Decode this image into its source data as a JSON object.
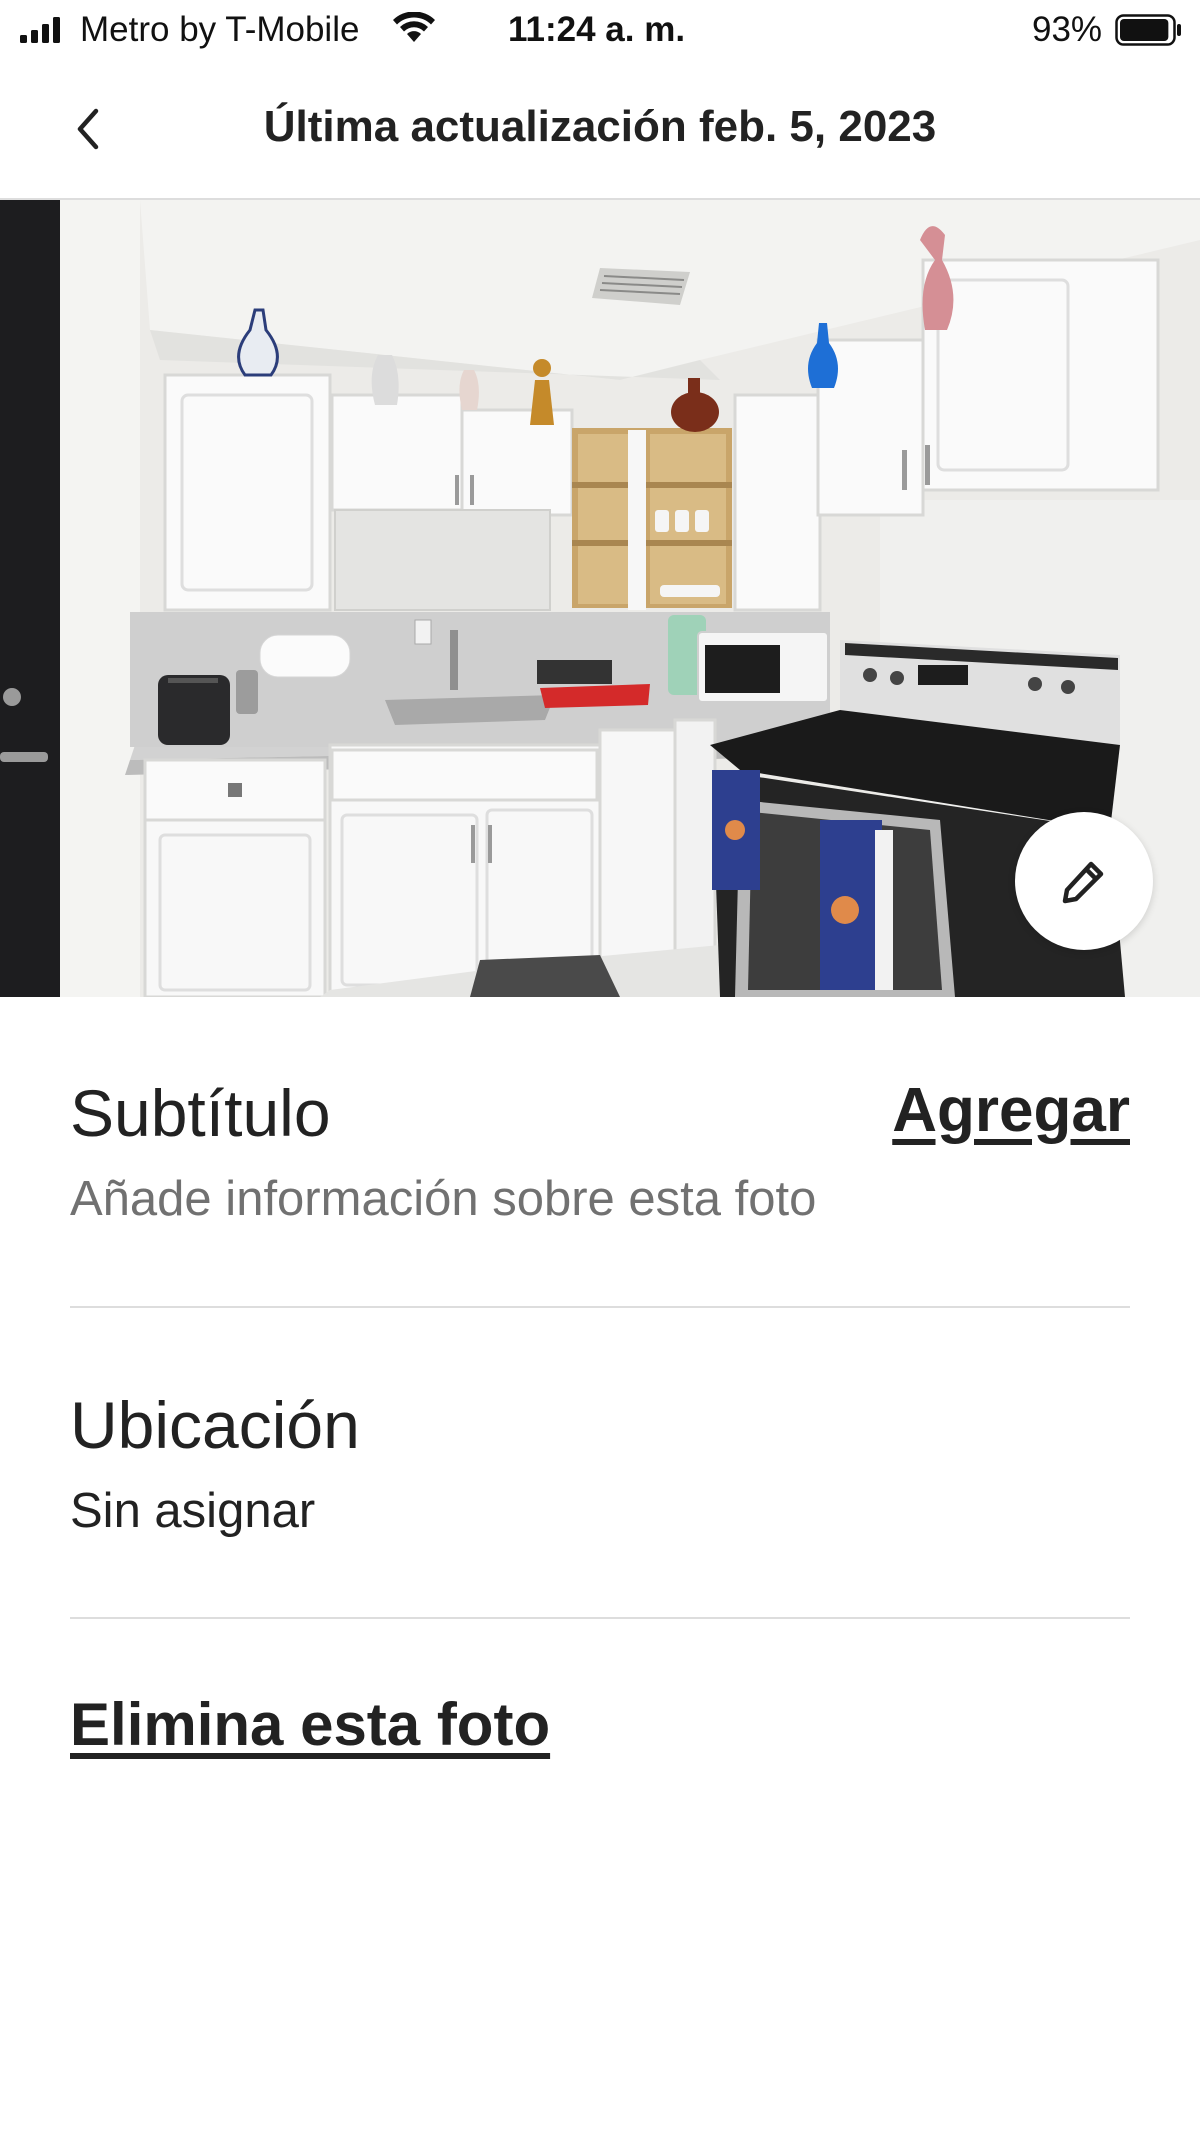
{
  "status_bar": {
    "carrier": "Metro by T-Mobile",
    "time": "11:24 a. m.",
    "battery_percent": "93%",
    "battery_level": 0.93,
    "signal_bars": 4,
    "icons": [
      "signal-bars-icon",
      "wifi-icon",
      "battery-icon"
    ]
  },
  "header": {
    "back_icon": "chevron-left-icon",
    "title": "Última actualización feb. 5, 2023"
  },
  "photo": {
    "description_icon": "edit-pencil-icon"
  },
  "caption_section": {
    "title": "Subtítulo",
    "action_label": "Agregar",
    "placeholder": "Añade información sobre esta foto"
  },
  "location_section": {
    "title": "Ubicación",
    "value": "Sin asignar"
  },
  "delete_label": "Elimina esta foto",
  "colors": {
    "text_primary": "#222222",
    "text_secondary": "#717171",
    "divider": "#dddddd",
    "background": "#ffffff"
  }
}
